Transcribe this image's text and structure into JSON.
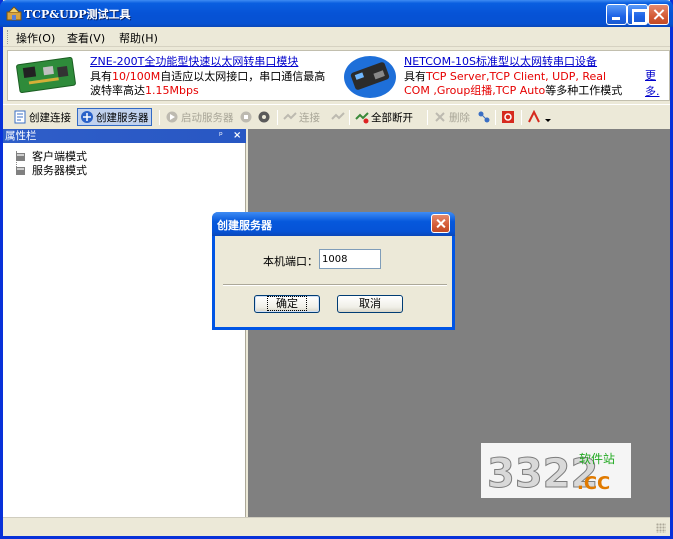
{
  "window": {
    "title": "TCP&UDP测试工具"
  },
  "menu": {
    "items": [
      "操作(O)",
      "查看(V)",
      "帮助(H)"
    ]
  },
  "banner": {
    "ad1": {
      "title": "ZNE-200T全功能型快速以太网转串口模块",
      "line1_a": "具有",
      "line1_red": "10/100M",
      "line1_b": "自适应以太网接口，串口通信最高",
      "line2_a": "波特率高达",
      "line2_red": "1.15Mbps"
    },
    "ad2": {
      "title": "NETCOM-10S标准型以太网转串口设备",
      "line1_a": "具有",
      "line1_red": "TCP Server,TCP Client, UDP, Real",
      "line2_red1": "COM ,Group组播,TCP Auto",
      "line2_b": "等多种工作模式"
    },
    "more": "更多."
  },
  "toolbar": {
    "create_connection": "创建连接",
    "create_server": "创建服务器",
    "start_server": "启动服务器",
    "connect": "连接",
    "disconnect_all": "全部断开",
    "delete": "删除"
  },
  "panel": {
    "title": "属性栏",
    "pin": "ᵖ",
    "close": "×",
    "tree": [
      "客户端模式",
      "服务器模式"
    ]
  },
  "dialog": {
    "title": "创建服务器",
    "port_label": "本机端口：",
    "port_value": "1008",
    "ok": "确定",
    "cancel": "取消"
  },
  "watermark": {
    "main": "3322",
    "sub": "软件站",
    "domain": ".CC"
  },
  "colors": {
    "titlebar": "#0653d6",
    "workspace": "#808080",
    "link": "#0000cc",
    "highlight": "#e60000"
  }
}
